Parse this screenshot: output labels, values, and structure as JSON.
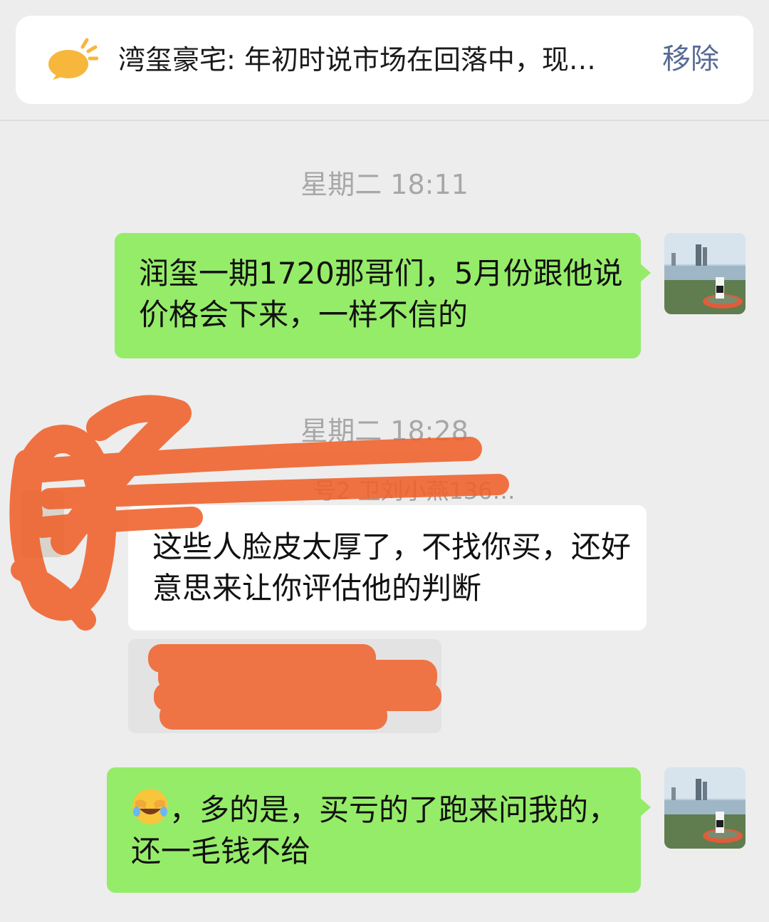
{
  "pinned": {
    "text": "湾玺豪宅: 年初时说市场在回落中，现…",
    "remove_label": "移除"
  },
  "chat": {
    "timestamps": [
      "星期二 18:11",
      "星期二 18:28"
    ],
    "sender_name": "号2 卫刘小燕136…",
    "messages": [
      {
        "direction": "outgoing",
        "text": "润玺一期1720那哥们，5月份跟他说价格会下来，一样不信的"
      },
      {
        "direction": "incoming",
        "text": "这些人脸皮太厚了，不找你买，还好意思来让你评估他的判断"
      },
      {
        "direction": "outgoing",
        "emoji": "face-with-tears-of-joy-covering",
        "text": "，多的是，买亏的了跑来问我的，还一毛钱不给"
      }
    ]
  },
  "colors": {
    "background": "#ededed",
    "outgoing_bubble": "#95ec69",
    "incoming_bubble": "#ffffff",
    "link_blue": "#576b95",
    "timestamp": "#a7a7a7",
    "redaction": "#f0602a"
  }
}
